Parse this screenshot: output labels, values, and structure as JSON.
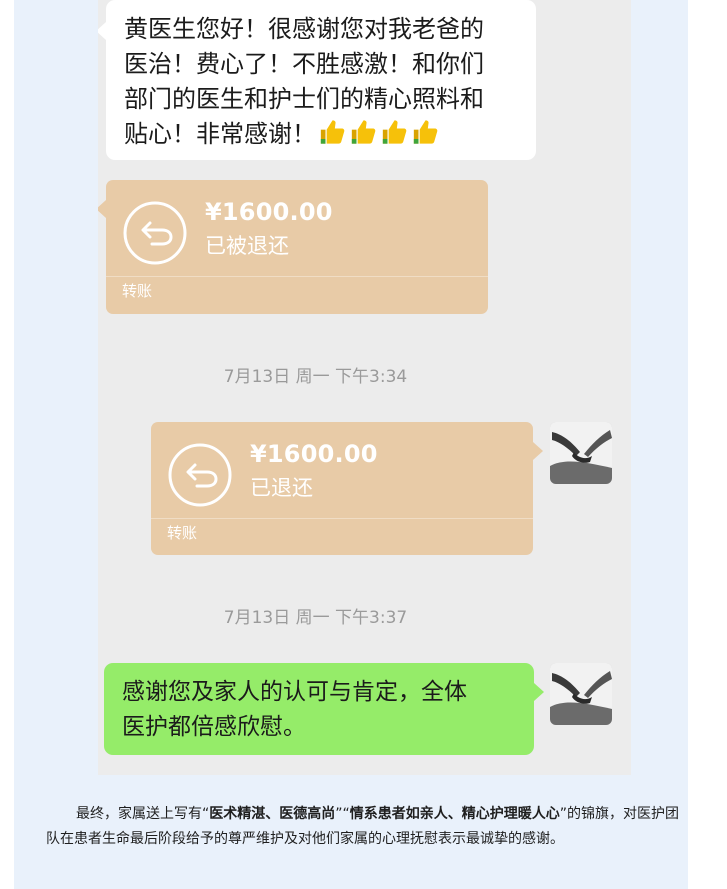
{
  "chat": {
    "first_message": "黄医生您好！很感谢您对我老爸的\n医治！费心了！不胜感激！和你们\n部门的医生和护士们的精心照料和\n贴心！非常感谢！",
    "first_message_emoji": "thumbs-up-icon x4",
    "transfer_1": {
      "amount": "¥1600.00",
      "status": "已被退还",
      "label": "转账"
    },
    "timestamp_1": "7月13日 周一 下午3:34",
    "transfer_2": {
      "amount": "¥1600.00",
      "status": "已退还",
      "label": "转账"
    },
    "timestamp_2": "7月13日 周一 下午3:37",
    "reply_message": "感谢您及家人的认可与肯定，全体\n医护都倍感欣慰。"
  },
  "caption": {
    "part1": "最终，家属送上写有“",
    "bold1": "医术精湛、医德高尚",
    "part2": "”“",
    "bold2": "情系患者如亲人、精心护理暖人心",
    "part3": "”的锦旗，对医护团队在患者生命最后阶段给予的尊严维护及对他们家属的心理抚慰表示最诚挚的感谢。"
  },
  "colors": {
    "transfer_bg": "#e8cba7",
    "sent_bubble": "#95ec69",
    "received_bubble": "#ffffff",
    "chat_bg": "#ececec"
  }
}
